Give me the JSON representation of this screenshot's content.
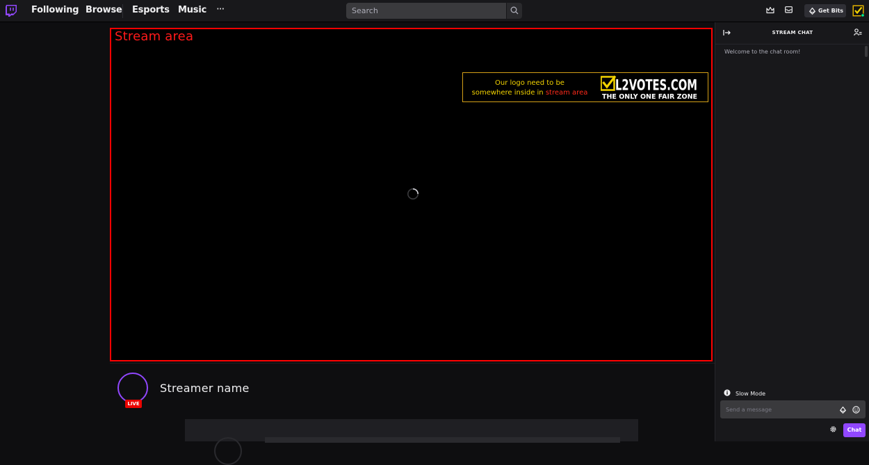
{
  "nav": {
    "links": [
      "Following",
      "Browse",
      "Esports",
      "Music"
    ],
    "more_glyph": "···",
    "search_placeholder": "Search",
    "get_bits_label": "Get Bits"
  },
  "stream": {
    "area_label": "Stream area",
    "banner_line1": "Our logo need to be",
    "banner_line2_prefix": "somewhere inside in ",
    "banner_line2_highlight": "stream area",
    "brand_logo_text": "L2VOTES.COM",
    "brand_logo_tagline": "THE ONLY ONE FAIR ZONE",
    "loading": true
  },
  "channel": {
    "streamer_name": "Streamer name",
    "live_badge": "LIVE"
  },
  "chat": {
    "title": "STREAM CHAT",
    "welcome": "Welcome to the chat room!",
    "slow_mode": "Slow Mode",
    "input_placeholder": "Send a message",
    "send_label": "Chat"
  },
  "colors": {
    "accent": "#9147ff",
    "stream_border": "#ff0000",
    "live": "#eb0400",
    "banner_yellow": "#f2d200"
  },
  "icons": [
    "twitch-logo-icon",
    "search-icon",
    "crown-icon",
    "inbox-icon",
    "bits-icon",
    "collapse-icon",
    "users-icon",
    "info-icon",
    "emote-icon",
    "settings-icon"
  ]
}
